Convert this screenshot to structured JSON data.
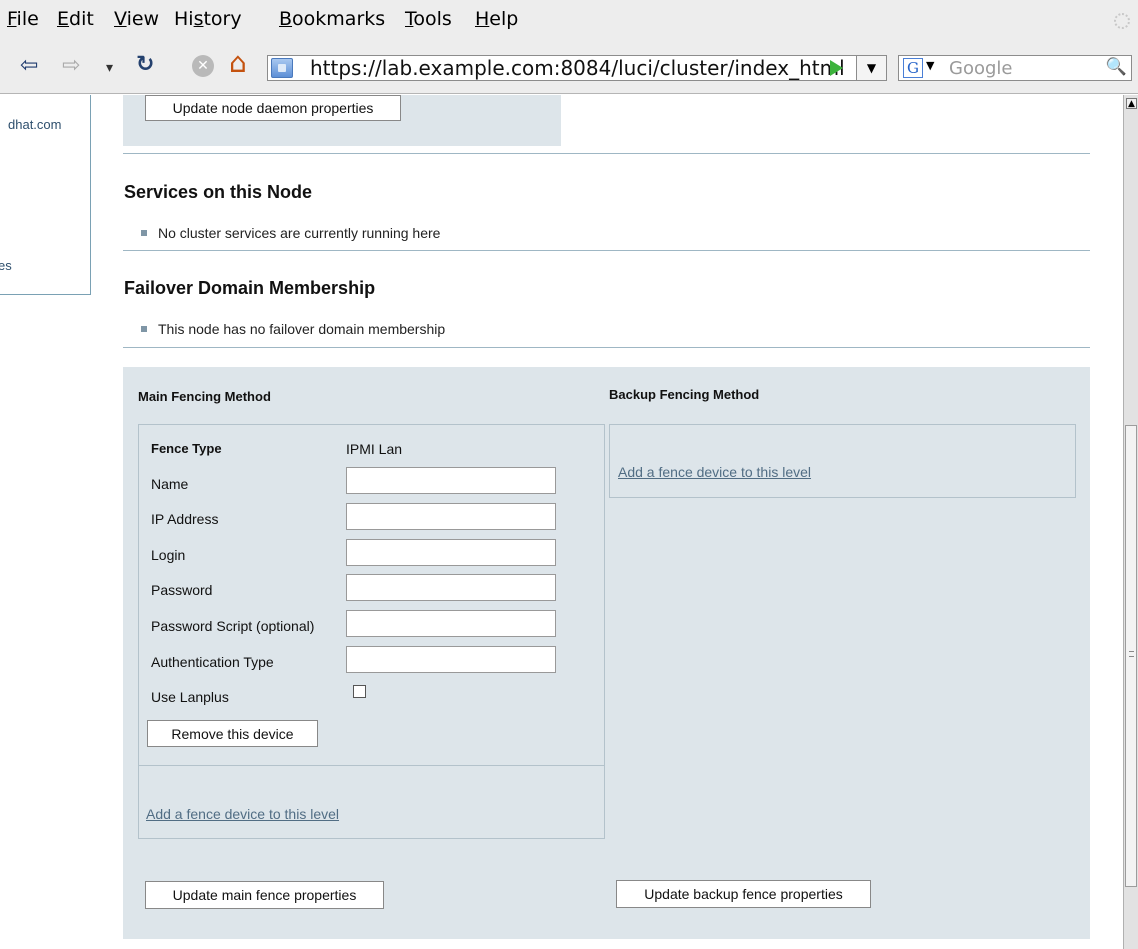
{
  "menu": {
    "items": [
      {
        "pre": "",
        "u": "F",
        "post": "ile"
      },
      {
        "pre": "",
        "u": "E",
        "post": "dit"
      },
      {
        "pre": "",
        "u": "V",
        "post": "iew"
      },
      {
        "pre": "Hi",
        "u": "s",
        "post": "tory"
      },
      {
        "pre": "",
        "u": "B",
        "post": "ookmarks"
      },
      {
        "pre": "",
        "u": "T",
        "post": "ools"
      },
      {
        "pre": "",
        "u": "H",
        "post": "elp"
      }
    ]
  },
  "toolbar": {
    "back": "⇦",
    "forward": "⇨",
    "history_dropdown": "▾",
    "reload": "↻",
    "stop": "✕",
    "home": "⌂",
    "url": "https://lab.example.com:8084/luci/cluster/index_html",
    "url_dropdown": "▼",
    "search_engine": "G",
    "search_engine_arrow": "▼",
    "search_placeholder": "Google",
    "search_icon": "🔍"
  },
  "leftnav": {
    "item1": "dhat.com",
    "item2": "es"
  },
  "page": {
    "update_daemon_button": "Update node daemon properties",
    "services_heading": "Services on this Node",
    "services_text": "No cluster services are currently running here",
    "failover_heading": "Failover Domain Membership",
    "failover_text": "This node has no failover domain membership",
    "main_fencing_title": "Main Fencing Method",
    "backup_fencing_title": "Backup Fencing Method",
    "fence_type_label": "Fence Type",
    "fence_type_value": "IPMI Lan",
    "fields": [
      {
        "label": "Name",
        "value": ""
      },
      {
        "label": "IP Address",
        "value": ""
      },
      {
        "label": "Login",
        "value": ""
      },
      {
        "label": "Password",
        "value": ""
      },
      {
        "label": "Password Script (optional)",
        "value": ""
      },
      {
        "label": "Authentication Type",
        "value": ""
      }
    ],
    "lanplus_label": "Use Lanplus",
    "lanplus_checked": false,
    "remove_device_button": "Remove this device",
    "add_fence_main_link": "Add a fence device to this level",
    "add_fence_backup_link": "Add a fence device to this level",
    "update_main_button": "Update main fence properties",
    "update_backup_button": "Update backup fence properties"
  }
}
